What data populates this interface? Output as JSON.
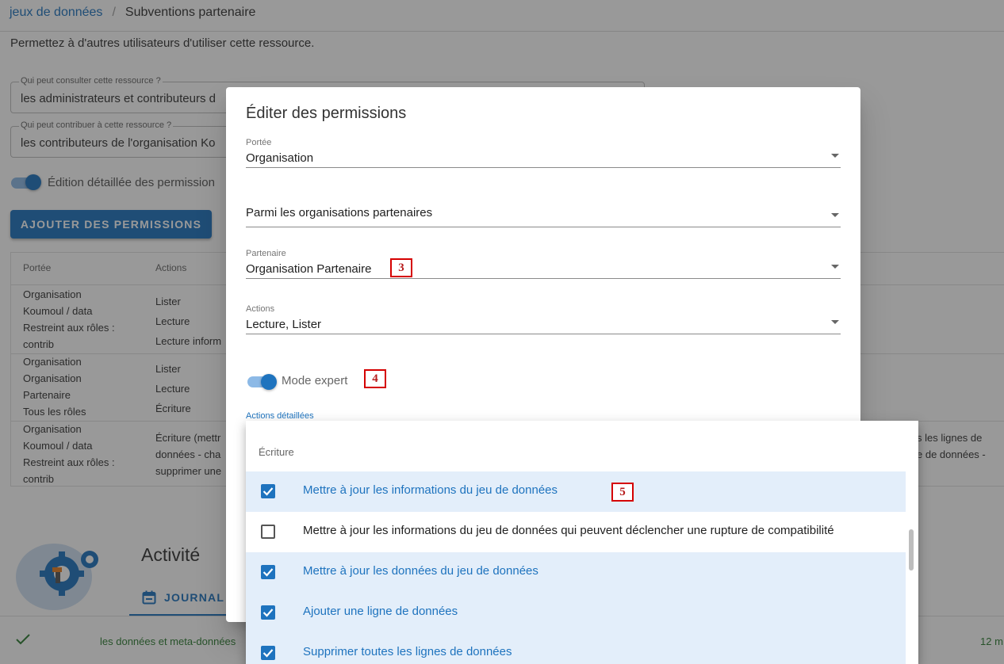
{
  "breadcrumb": {
    "parent": "jeux de données",
    "separator": "/",
    "current": "Subventions partenaire"
  },
  "intro": "Permettez à d'autres utilisateurs d'utiliser cette ressource.",
  "consult_field": {
    "label": "Qui peut consulter cette ressource ?",
    "value": "les administrateurs et contributeurs d"
  },
  "contrib_field": {
    "label": "Qui peut contribuer à cette ressource ?",
    "value": "les contributeurs de l'organisation Ko"
  },
  "detailed_switch_label": "Édition détaillée des permission",
  "add_button": "AJOUTER DES PERMISSIONS",
  "table": {
    "headers": [
      "Portée",
      "Actions"
    ],
    "rows": [
      {
        "scope": [
          "Organisation",
          "Koumoul / data",
          "Restreint aux rôles :",
          "contrib"
        ],
        "actions": [
          "Lister",
          "Lecture",
          "Lecture inform"
        ]
      },
      {
        "scope": [
          "Organisation",
          "Organisation",
          "Partenaire",
          "Tous les rôles"
        ],
        "actions": [
          "Lister",
          "Lecture",
          "Écriture"
        ]
      },
      {
        "scope": [
          "Organisation",
          "Koumoul / data",
          "Restreint aux rôles :",
          "contrib"
        ],
        "actions": [
          "Écriture (mettr",
          "données - cha",
          "supprimer une"
        ]
      }
    ],
    "right_fragment": [
      "s les lignes de",
      "e de données -"
    ]
  },
  "activity": {
    "title": "Activité",
    "tab": "JOURNAL",
    "entry_text": "les données et meta-données",
    "entry_time": "12 m"
  },
  "dialog": {
    "title": "Éditer des permissions",
    "scope": {
      "label": "Portée",
      "value": "Organisation"
    },
    "org_scope": {
      "value": "Parmi les organisations partenaires"
    },
    "partner": {
      "label": "Partenaire",
      "value": "Organisation Partenaire"
    },
    "actions": {
      "label": "Actions",
      "value": "Lecture, Lister"
    },
    "expert_mode": "Mode expert",
    "detailed_actions_label": "Actions détaillées"
  },
  "markers": {
    "partner": "3",
    "expert": "4",
    "menu": "5"
  },
  "menu": {
    "subheader": "Écriture",
    "items": [
      {
        "label": "Mettre à jour les informations du jeu de données",
        "checked": true
      },
      {
        "label": "Mettre à jour les informations du jeu de données qui peuvent déclencher une rupture de compatibilité",
        "checked": false
      },
      {
        "label": "Mettre à jour les données du jeu de données",
        "checked": true
      },
      {
        "label": "Ajouter une ligne de données",
        "checked": true
      },
      {
        "label": "Supprimer toutes les lignes de données",
        "checked": true
      }
    ]
  },
  "colors": {
    "primary": "#1e73be",
    "selected_bg": "#e3eefa",
    "marker": "#d50000",
    "success": "#2e7d32"
  }
}
